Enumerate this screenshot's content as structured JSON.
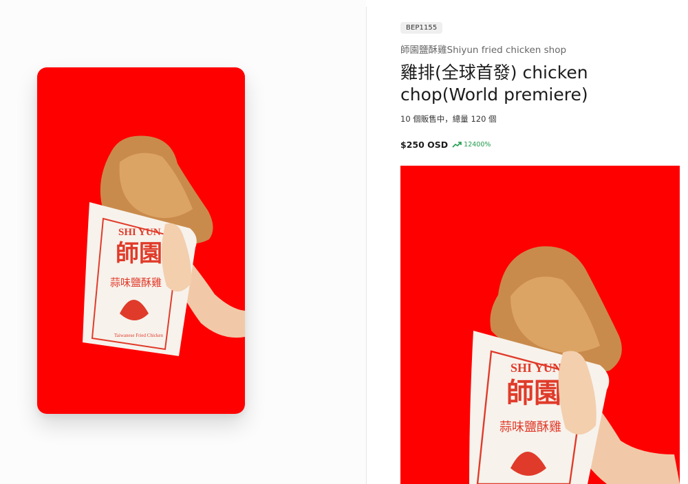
{
  "product": {
    "sku": "BEP1155",
    "shop_name": "師園鹽酥雞Shiyun fried chicken shop",
    "title": "雞排(全球首發) chicken chop(World premiere)",
    "stock_text": "10 個販售中，總量 120 個",
    "price": "$250 OSD",
    "change_percent": "12400%"
  },
  "image": {
    "bag_brand": "SHI YUN",
    "bag_chinese_name": "師園",
    "bag_subtitle": "蒜味鹽酥雞",
    "bag_caption": "Taiwanese Fried Chicken",
    "background_color": "#ff0000"
  },
  "icons": {
    "trend": "trending-up-icon"
  },
  "colors": {
    "accent_green": "#1d9a4b",
    "badge_bg": "#efefef"
  }
}
